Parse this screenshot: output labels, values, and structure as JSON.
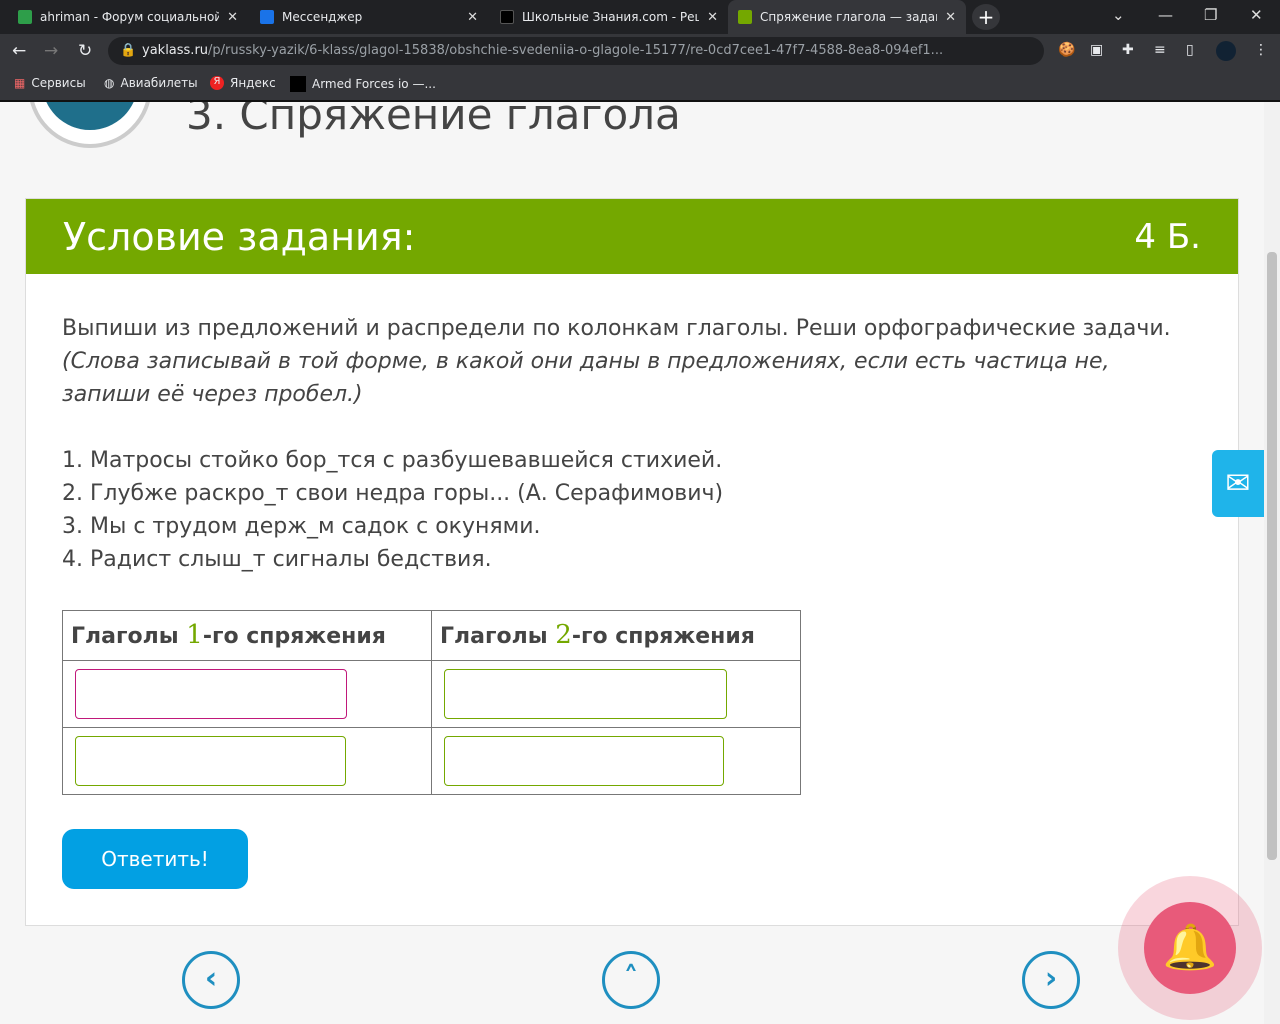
{
  "browser": {
    "tabs": [
      {
        "label": "ahriman - Форум социальной и",
        "color": "#2e9e4a"
      },
      {
        "label": "Мессенджер",
        "color": "#1a73e8"
      },
      {
        "label": "Школьные Знания.com - Решае",
        "color": "#000000"
      },
      {
        "label": "Спряжение глагола — задание",
        "color": "#74a800"
      }
    ],
    "url_domain": "yaklass.ru",
    "url_path": "/p/russky-yazik/6-klass/glagol-15838/obshchie-svedeniia-o-glagole-15177/re-0cd7cee1-47f7-4588-8ea8-094ef1...",
    "bookmarks": [
      "Сервисы",
      "Авиабилеты",
      "Яндекс",
      "Armed Forces io —..."
    ]
  },
  "page": {
    "title": "3. Спряжение глагола",
    "card_header": "Условие задания:",
    "points": "4 Б.",
    "instruction": "Выпиши из предложений и распредели по колонкам глаголы. Реши орфографические задачи.",
    "note": "(Слова записывай в той форме, в какой они даны в предложениях, если есть частица не, запиши её через пробел.)",
    "sentences": [
      "1. Матросы стойко бор_тся с разбушевавшейся стихией.",
      "2. Глубже раскро_т свои недра горы... (А. Серафимович)",
      "3. Мы с трудом держ_м садок с окунями.",
      "4. Радист слыш_т сигналы бедствия."
    ],
    "col1": {
      "pre": "Глаголы ",
      "num": "1",
      "post": "-го спряжения"
    },
    "col2": {
      "pre": "Глаголы ",
      "num": "2",
      "post": "-го спряжения"
    },
    "answers": [
      "",
      "",
      "",
      ""
    ],
    "submit": "Ответить!"
  }
}
